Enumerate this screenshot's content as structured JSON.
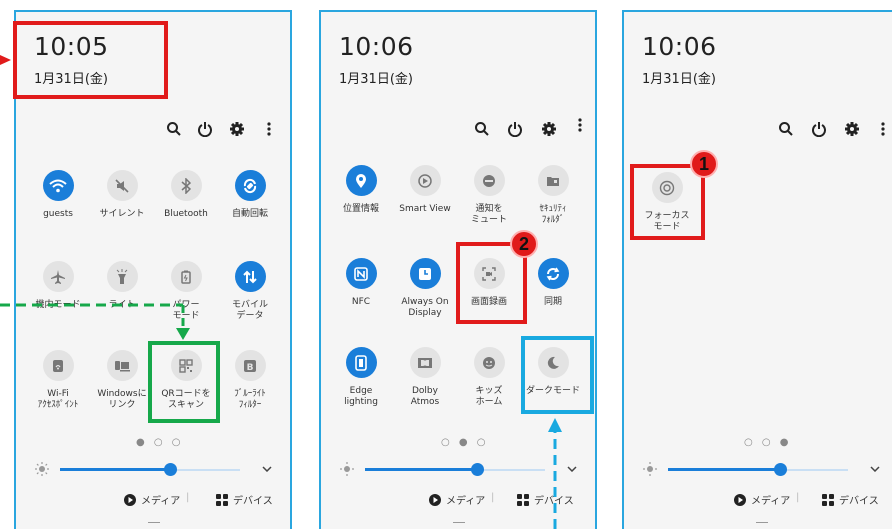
{
  "colors": {
    "accent": "#1a7ed9",
    "frame": "#2aa6df",
    "highlight_red": "#e11b1b",
    "highlight_green": "#16a84a",
    "highlight_blue": "#19a9e0"
  },
  "panel1": {
    "time": "10:05",
    "date": "1月31日(金)",
    "tiles": [
      {
        "label": "guests",
        "icon": "wifi-icon",
        "on": true
      },
      {
        "label": "サイレント",
        "icon": "mute-icon",
        "on": false
      },
      {
        "label": "Bluetooth",
        "icon": "bluetooth-icon",
        "on": false
      },
      {
        "label": "自動回転",
        "icon": "auto-rotate-icon",
        "on": true
      },
      {
        "label": "機内モード",
        "icon": "airplane-icon",
        "on": false
      },
      {
        "label": "ライト",
        "icon": "flashlight-icon",
        "on": false
      },
      {
        "label": "パワー\nモード",
        "icon": "power-mode-icon",
        "on": false
      },
      {
        "label": "モバイル\nデータ",
        "icon": "mobile-data-icon",
        "on": true
      },
      {
        "label": "Wi-Fi\nｱｸｾｽﾎﾟｲﾝﾄ",
        "icon": "hotspot-icon",
        "on": false
      },
      {
        "label": "Windowsに\nリンク",
        "icon": "link-windows-icon",
        "on": false
      },
      {
        "label": "QRコードを\nスキャン",
        "icon": "qr-code-icon",
        "on": false
      },
      {
        "label": "ﾌﾞﾙｰﾗｲﾄ\nﾌｨﾙﾀｰ",
        "icon": "blue-light-icon",
        "on": false
      }
    ],
    "page_dots": "● ○ ○",
    "media": "メディア",
    "devices": "デバイス"
  },
  "panel2": {
    "time": "10:06",
    "date": "1月31日(金)",
    "tiles": [
      {
        "label": "位置情報",
        "icon": "location-icon",
        "on": true
      },
      {
        "label": "Smart View",
        "icon": "smart-view-icon",
        "on": false
      },
      {
        "label": "通知を\nミュート",
        "icon": "mute-notification-icon",
        "on": false
      },
      {
        "label": "ｾｷｭﾘﾃｨ\nﾌｫﾙﾀﾞ",
        "icon": "secure-folder-icon",
        "on": false
      },
      {
        "label": "NFC",
        "icon": "nfc-icon",
        "on": true
      },
      {
        "label": "Always On\nDisplay",
        "icon": "always-on-display-icon",
        "on": true
      },
      {
        "label": "画面録画",
        "icon": "screen-record-icon",
        "on": false
      },
      {
        "label": "同期",
        "icon": "sync-icon",
        "on": true
      },
      {
        "label": "Edge\nlighting",
        "icon": "edge-lighting-icon",
        "on": true
      },
      {
        "label": "Dolby\nAtmos",
        "icon": "dolby-icon",
        "on": false
      },
      {
        "label": "キッズ\nホーム",
        "icon": "kids-home-icon",
        "on": false
      },
      {
        "label": "ダークモード",
        "icon": "dark-mode-icon",
        "on": false
      }
    ],
    "page_dots": "○ ● ○",
    "media": "メディア",
    "devices": "デバイス"
  },
  "panel3": {
    "time": "10:06",
    "date": "1月31日(金)",
    "tiles": [
      {
        "label": "フォーカス\nモード",
        "icon": "focus-mode-icon",
        "on": false
      }
    ],
    "page_dots": "○ ○ ●",
    "media": "メディア",
    "devices": "デバイス"
  },
  "badges": {
    "one": "1",
    "two": "2"
  }
}
